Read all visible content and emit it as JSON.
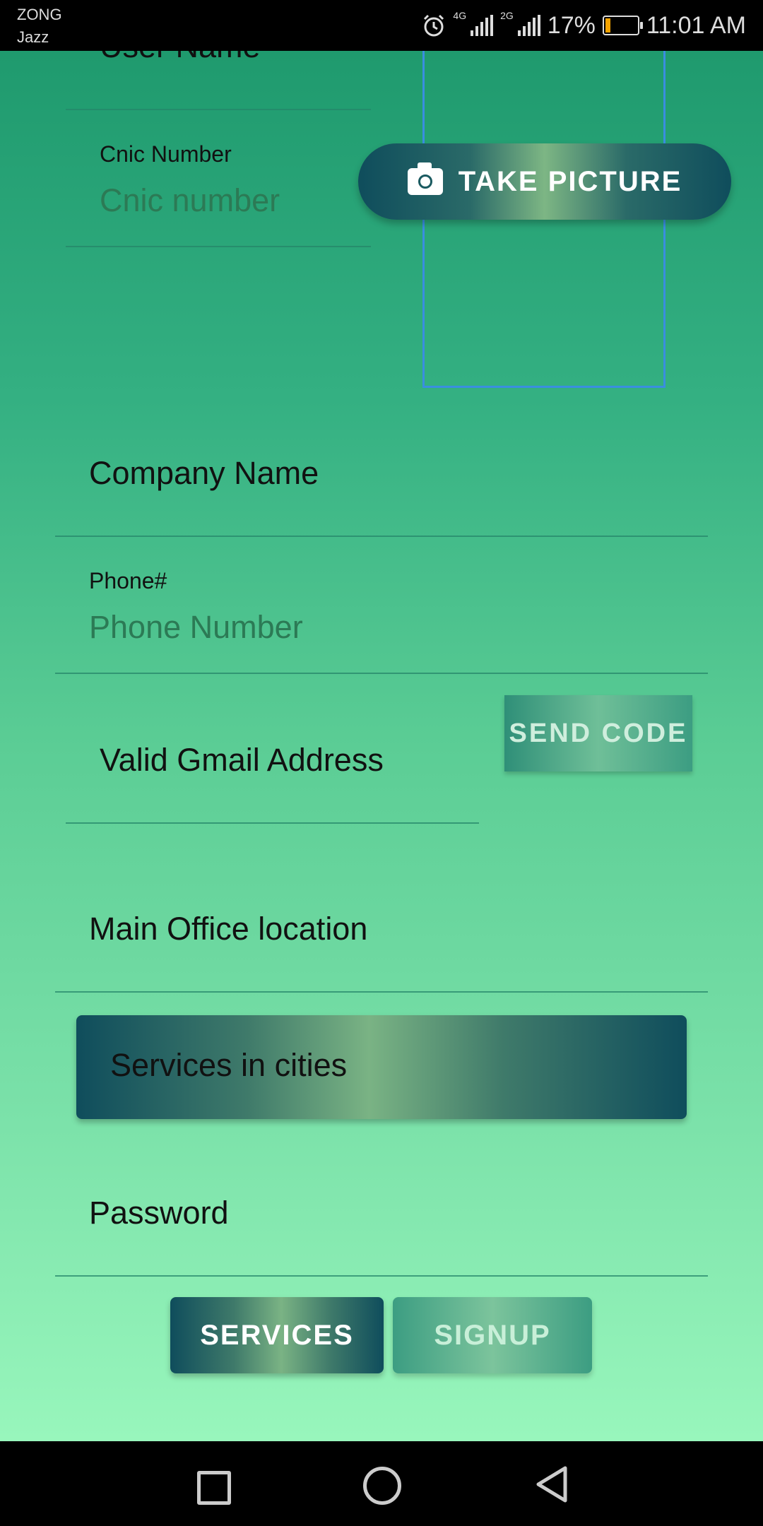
{
  "status_bar": {
    "carrier_1": "ZONG",
    "carrier_2": "Jazz",
    "network_1": "4G",
    "network_2": "2G",
    "battery_percent": "17%",
    "battery_level": 0.17,
    "time": "11:01 AM"
  },
  "form": {
    "user_name_label": "User Name",
    "cnic_label": "Cnic Number",
    "cnic_placeholder": "Cnic number",
    "take_picture_label": "TAKE PICTURE",
    "company_name_label": "Company Name",
    "phone_label": "Phone#",
    "phone_placeholder": "Phone Number",
    "gmail_label": "Valid Gmail Address",
    "send_code_label": "SEND CODE",
    "main_office_label": "Main Office location",
    "services_cities_label": "Services in cities",
    "password_label": "Password"
  },
  "actions": {
    "services_label": "SERVICES",
    "signup_label": "SIGNUP"
  },
  "icons": {
    "camera": "camera-icon",
    "alarm": "alarm-icon",
    "battery": "battery-icon",
    "nav_recent": "square-icon",
    "nav_home": "circle-icon",
    "nav_back": "triangle-back-icon"
  },
  "colors": {
    "primary_dark": "#0f4d5c",
    "accent_green": "#7db684",
    "background_top": "#1f9a6e",
    "background_bottom": "#98f6bc"
  }
}
